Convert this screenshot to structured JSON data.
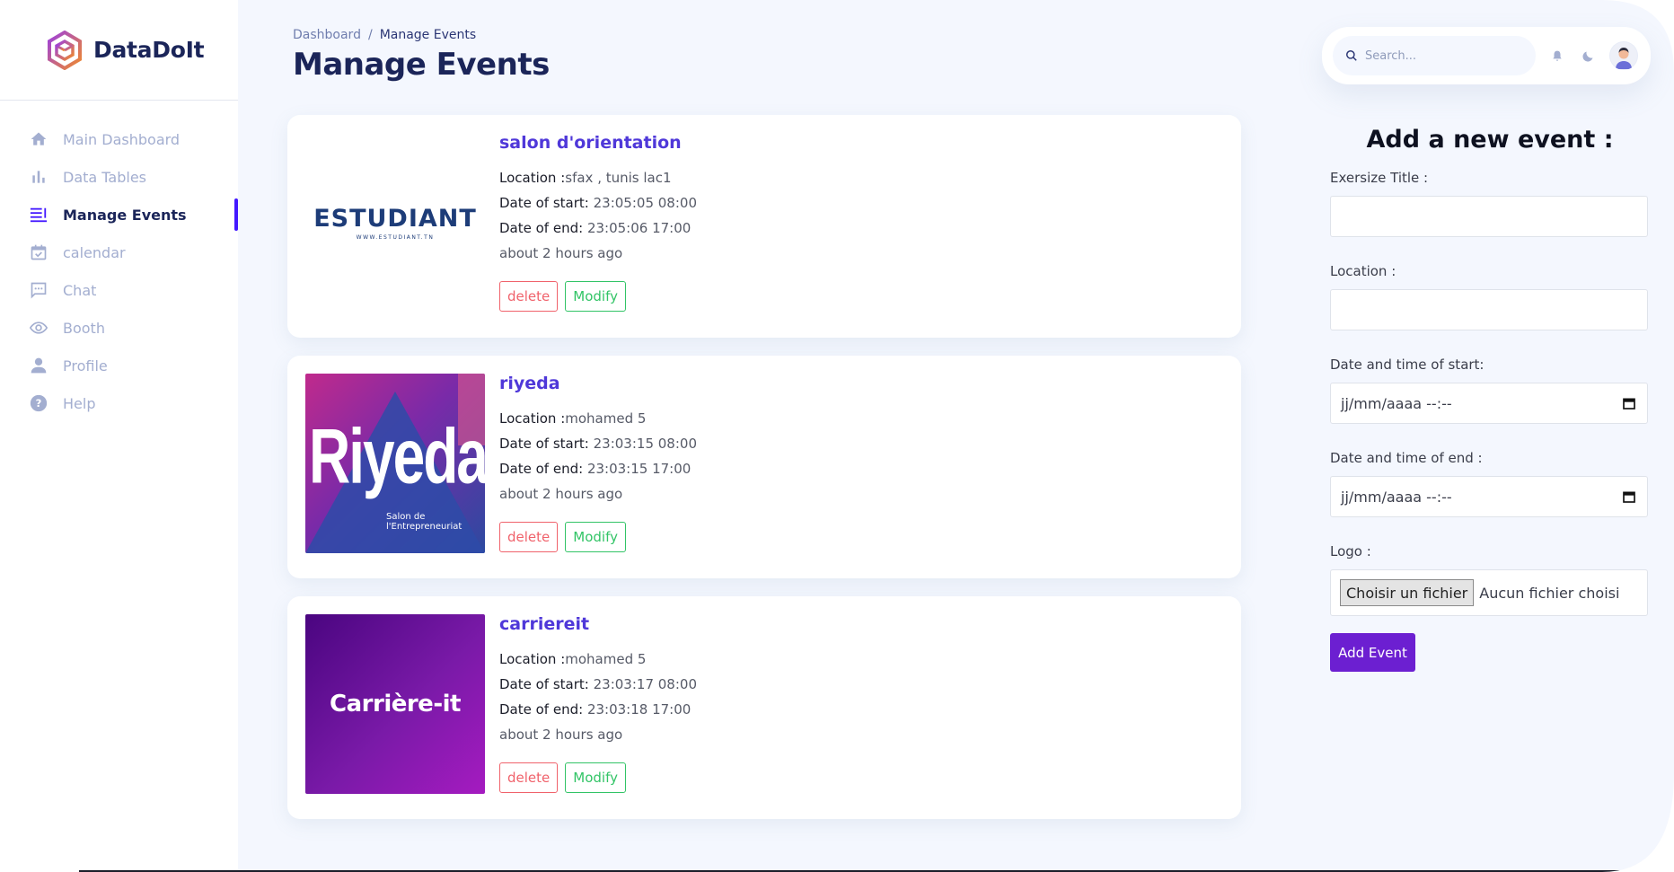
{
  "app": {
    "brand": "DataDoIt"
  },
  "sidebar": {
    "items": [
      {
        "label": "Main Dashboard",
        "icon": "home-icon"
      },
      {
        "label": "Data Tables",
        "icon": "bar-chart-icon"
      },
      {
        "label": "Manage Events",
        "icon": "list-icon",
        "active": true
      },
      {
        "label": "calendar",
        "icon": "calendar-icon"
      },
      {
        "label": "Chat",
        "icon": "chat-icon"
      },
      {
        "label": "Booth",
        "icon": "eye-icon"
      },
      {
        "label": "Profile",
        "icon": "person-icon"
      },
      {
        "label": "Help",
        "icon": "help-icon"
      }
    ]
  },
  "header": {
    "breadcrumb": [
      "Dashboard",
      "/",
      "Manage Events"
    ],
    "title": "Manage Events",
    "search_placeholder": "Search..."
  },
  "events": [
    {
      "title": "salon d'orientation",
      "location_label": "Location :",
      "location": "sfax , tunis lac1",
      "start_label": "Date of start:",
      "start": "23:05:05 08:00",
      "end_label": "Date of end:",
      "end": "23:05:06 17:00",
      "ago": "about 2 hours ago",
      "logo_text": "ESTUDIANT",
      "logo_sub": "WWW.ESTUDIANT.TN"
    },
    {
      "title": "riyeda",
      "location_label": "Location :",
      "location": "mohamed 5",
      "start_label": "Date of start:",
      "start": "23:03:15 08:00",
      "end_label": "Date of end:",
      "end": "23:03:15 17:00",
      "ago": "about 2 hours ago",
      "logo_text": "Riyeda",
      "logo_sub": "Salon de l'Entrepreneuriat"
    },
    {
      "title": "carriereit",
      "location_label": "Location :",
      "location": "mohamed 5",
      "start_label": "Date of start:",
      "start": "23:03:17 08:00",
      "end_label": "Date of end:",
      "end": "23:03:18 17:00",
      "ago": "about 2 hours ago",
      "logo_text": "Carrière-it"
    }
  ],
  "actions": {
    "delete": "delete",
    "modify": "Modify"
  },
  "form": {
    "title": "Add a new event :",
    "title_label": "Exersize Title :",
    "location_label": "Location :",
    "start_label": "Date and time of start:",
    "end_label": "Date and time of end :",
    "datetime_placeholder": "jj/mm/aaaa --:--",
    "logo_label": "Logo :",
    "file_button": "Choisir un fichier",
    "file_status": "Aucun fichier choisi",
    "submit": "Add Event"
  },
  "colors": {
    "accent": "#4318ff",
    "event_title": "#4f38d9",
    "delete": "#f0626b",
    "modify": "#32c466",
    "submit": "#6c1fd1"
  }
}
